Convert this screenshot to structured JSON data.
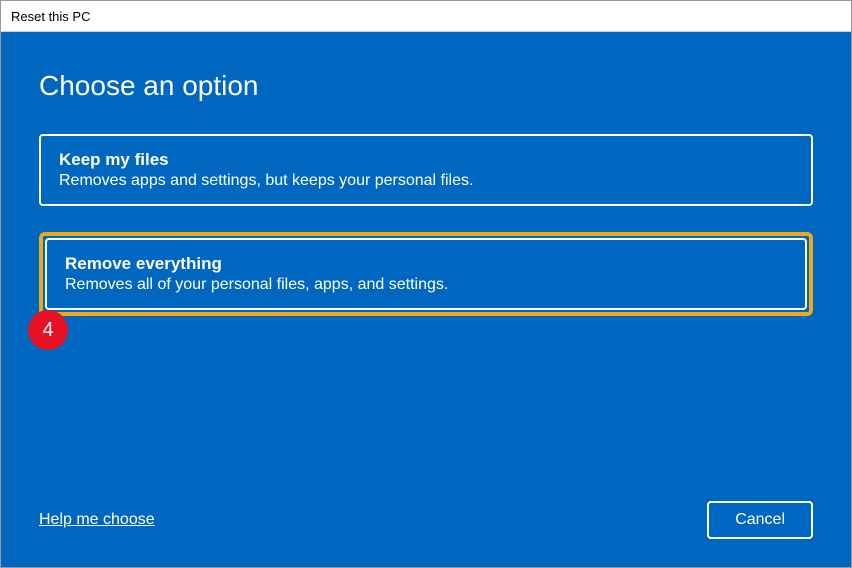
{
  "window": {
    "title": "Reset this PC"
  },
  "main": {
    "heading": "Choose an option",
    "options": [
      {
        "title": "Keep my files",
        "description": "Removes apps and settings, but keeps your personal files."
      },
      {
        "title": "Remove everything",
        "description": "Removes all of your personal files, apps, and settings."
      }
    ]
  },
  "annotation": {
    "step_number": "4",
    "highlight_color": "#f0a818",
    "badge_color": "#e81123"
  },
  "footer": {
    "help_link": "Help me choose",
    "cancel_label": "Cancel"
  },
  "colors": {
    "background": "#0067c0",
    "foreground": "#ffffff"
  }
}
